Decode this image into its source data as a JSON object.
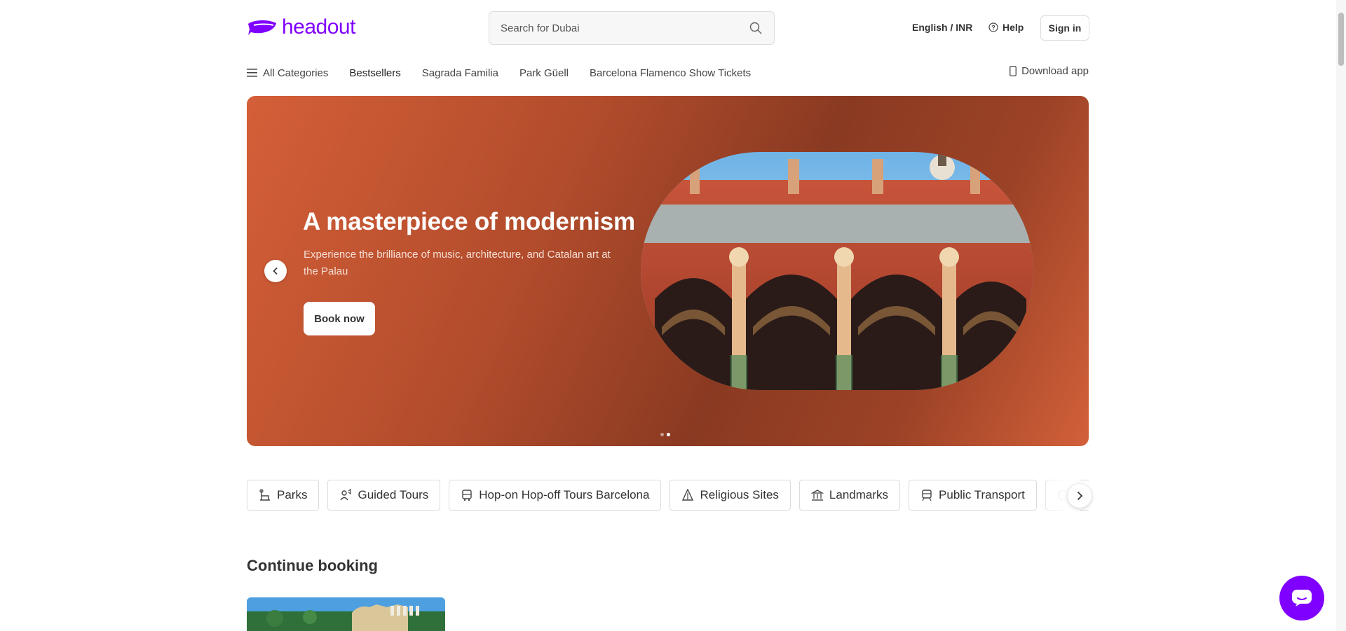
{
  "header": {
    "logo_text": "headout",
    "search_placeholder": "Search for Dubai",
    "language_currency": "English / INR",
    "help_label": "Help",
    "signin_label": "Sign in"
  },
  "nav": {
    "all_categories": "All Categories",
    "items": [
      "Bestsellers",
      "Sagrada Familia",
      "Park Güell",
      "Barcelona Flamenco Show Tickets"
    ],
    "download_app": "Download app"
  },
  "hero": {
    "title": "A masterpiece of modernism",
    "subtitle": "Experience the brilliance of music, architecture, and Catalan art at the Palau",
    "button_label": "Book now",
    "slide_count": 2,
    "active_slide": 2
  },
  "categories": [
    {
      "label": "Parks",
      "icon": "park-bench-icon"
    },
    {
      "label": "Guided Tours",
      "icon": "guide-icon"
    },
    {
      "label": "Hop-on Hop-off Tours Barcelona",
      "icon": "bus-icon"
    },
    {
      "label": "Religious Sites",
      "icon": "religious-site-icon"
    },
    {
      "label": "Landmarks",
      "icon": "landmark-icon"
    },
    {
      "label": "Public Transport",
      "icon": "tram-icon"
    }
  ],
  "continue_booking": {
    "title": "Continue booking"
  },
  "colors": {
    "brand": "#8000ff",
    "hero_bg": "#b24c2c"
  }
}
